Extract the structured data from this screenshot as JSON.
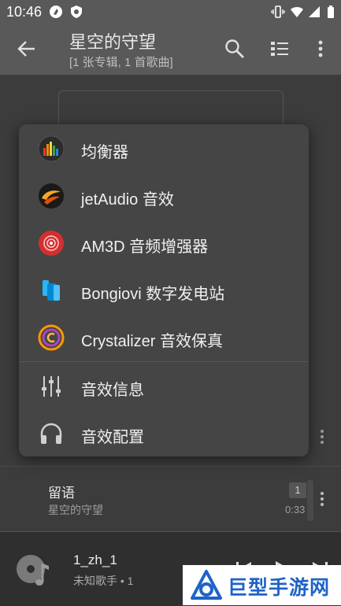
{
  "status_bar": {
    "time": "10:46"
  },
  "toolbar": {
    "title": "星空的守望",
    "subtitle": "[1 张专辑, 1 首歌曲]"
  },
  "menu": {
    "items": [
      {
        "label": "均衡器",
        "icon": "equalizer-bars-icon"
      },
      {
        "label": "jetAudio 音效",
        "icon": "jetaudio-logo-icon"
      },
      {
        "label": "AM3D 音频增强器",
        "icon": "am3d-logo-icon"
      },
      {
        "label": "Bongiovi 数字发电站",
        "icon": "bongiovi-logo-icon"
      },
      {
        "label": "Crystalizer 音效保真",
        "icon": "crystalizer-logo-icon"
      },
      {
        "label": "音效信息",
        "icon": "sliders-icon"
      },
      {
        "label": "音效配置",
        "icon": "headphones-icon"
      }
    ]
  },
  "song": {
    "title": "留语",
    "album": "星空的守望",
    "track_number": "1",
    "duration": "0:33"
  },
  "now_playing": {
    "title": "1_zh_1",
    "artist": "未知歌手 • 1"
  },
  "watermark": {
    "text": "巨型手游网"
  },
  "colors": {
    "toolbar_bg": "#595959",
    "menu_bg": "#454545",
    "watermark_blue": "#1e63c8"
  }
}
